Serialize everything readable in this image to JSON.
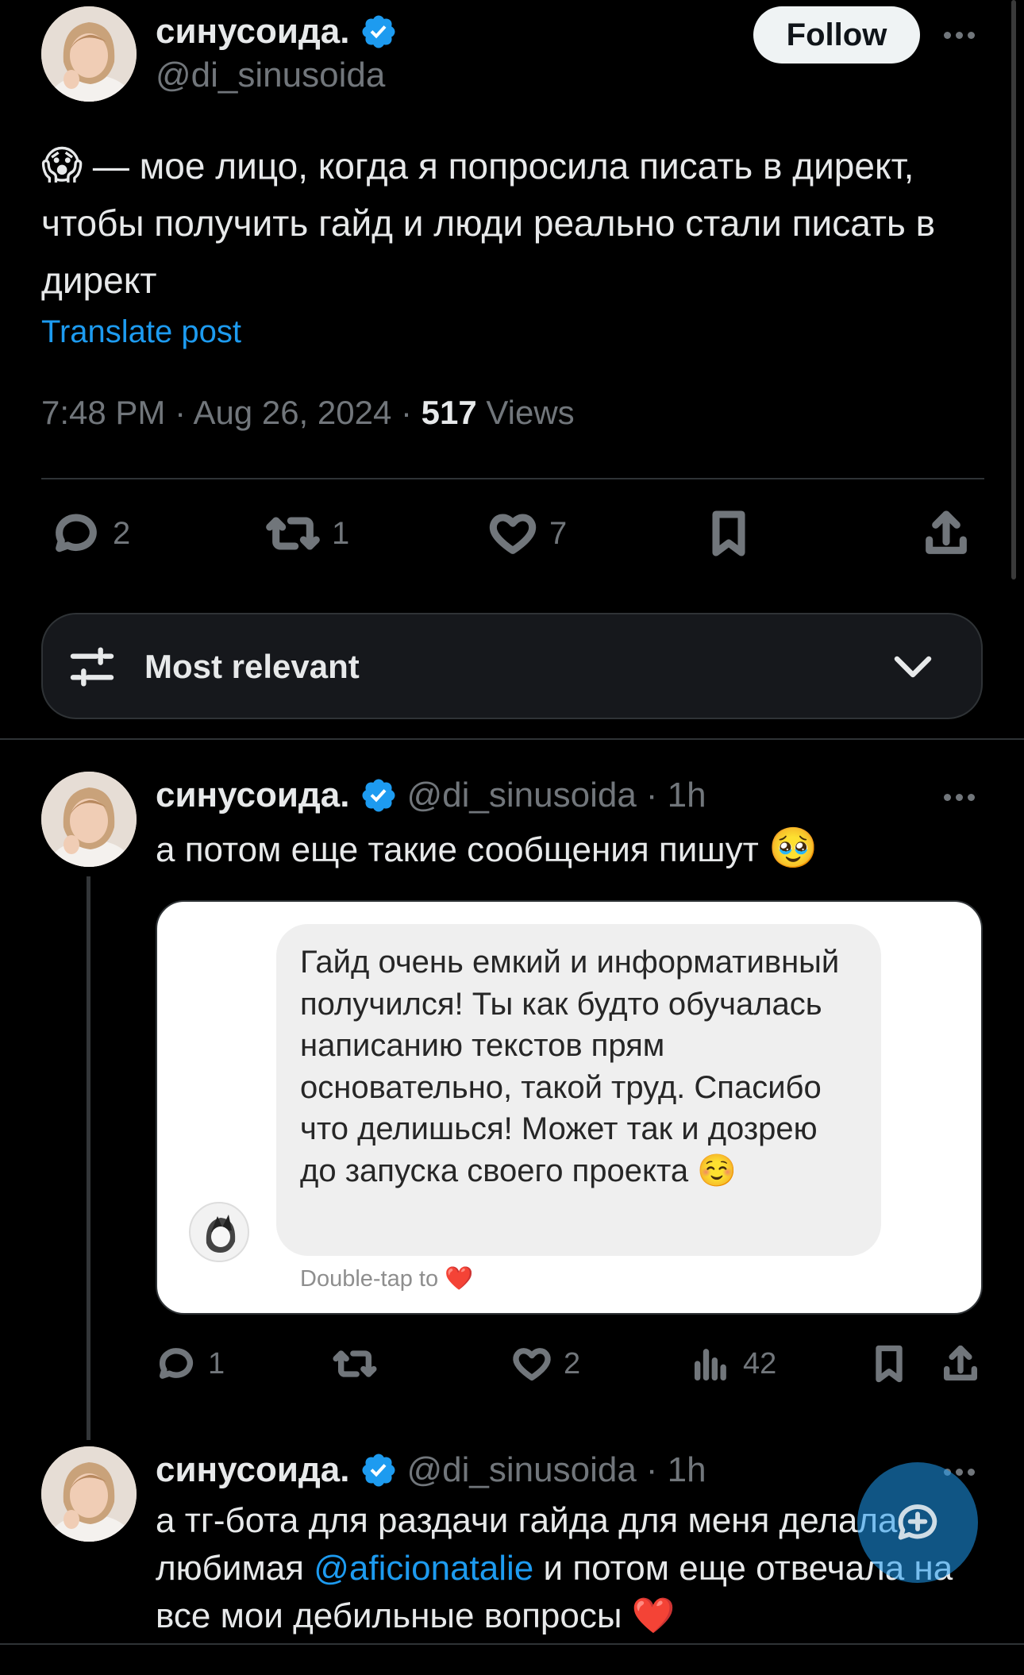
{
  "main_post": {
    "author_name": "синусоида.",
    "author_handle": "@di_sinusoida",
    "follow_label": "Follow",
    "text_emoji": "😱",
    "text": "— мое лицо, когда я попросила писать в директ, чтобы получить гайд и люди реально стали писать в директ",
    "translate_label": "Translate post",
    "time": "7:48 PM",
    "date": "Aug 26, 2024",
    "views_count": "517",
    "views_label": "Views",
    "actions": {
      "replies": "2",
      "reposts": "1",
      "likes": "7"
    }
  },
  "sort": {
    "label": "Most relevant"
  },
  "replies": [
    {
      "author_name": "синусоида.",
      "author_handle": "@di_sinusoida",
      "time": "· 1h",
      "text": "а потом еще такие сообщения пишут",
      "text_emoji": "🥹",
      "screenshot": {
        "message": "Гайд очень емкий и информативный получился! Ты как будто обучалась написанию текстов прям основательно, такой труд. Спасибо что делишься! Может так и дозрею до запуска своего проекта",
        "message_emoji": "☺️",
        "hint": "Double-tap to",
        "hint_emoji": "❤️"
      },
      "actions": {
        "replies": "1",
        "reposts": "",
        "likes": "2",
        "views": "42"
      }
    },
    {
      "author_name": "синусоида.",
      "author_handle": "@di_sinusoida",
      "time": "· 1h",
      "text_before": "а тг-бота для раздачи гайда для меня делала любимая",
      "mention": "@aficionatalie",
      "text_after": "и потом еще отвечала на все мои дебильные вопросы",
      "text_emoji": "❤️"
    }
  ],
  "colors": {
    "accent": "#1d9bf0",
    "muted": "#71767b",
    "background": "#000000",
    "text": "#e7e9ea"
  }
}
